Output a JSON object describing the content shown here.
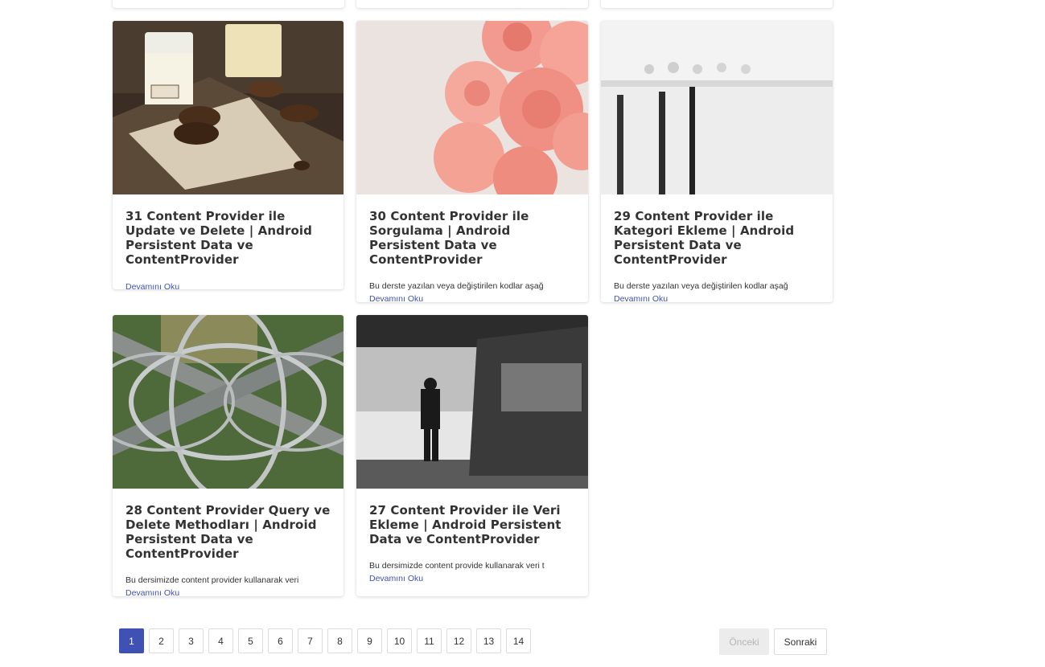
{
  "posts": [
    {
      "title": "31 Content Provider ile Update ve Delete | Android Persistent Data ve ContentProvider",
      "excerpt": "",
      "read_more": "Devamını Oku",
      "image_icon": "milk-cookies-photo"
    },
    {
      "title": "30 Content Provider ile Sorgulama | Android Persistent Data ve ContentProvider",
      "excerpt": "Bu derste yazılan veya değiştirilen kodlar aşağ",
      "read_more": "Devamını Oku",
      "image_icon": "pink-roses-photo"
    },
    {
      "title": "29 Content Provider ile Kategori Ekleme | Android Persistent Data ve ContentProvider",
      "excerpt": "Bu derste yazılan veya değiştirilen kodlar aşağ",
      "read_more": "Devamını Oku",
      "image_icon": "foggy-lake-posts-photo"
    },
    {
      "title": "28 Content Provider Query ve Delete Methodları | Android Persistent Data ve ContentProvider",
      "excerpt": "Bu dersimizde content provider kullanarak veri",
      "read_more": "Devamını Oku",
      "image_icon": "highway-interchange-photo"
    },
    {
      "title": "27 Content Provider ile Veri Ekleme | Android Persistent Data ve ContentProvider",
      "excerpt": "Bu dersimizde content provide kullanarak veri t",
      "read_more": "Devamını Oku",
      "image_icon": "subway-platform-photo"
    }
  ],
  "pagination": {
    "pages": [
      "1",
      "2",
      "3",
      "4",
      "5",
      "6",
      "7",
      "8",
      "9",
      "10",
      "11",
      "12",
      "13",
      "14"
    ],
    "current": "1",
    "prev_label": "Önceki",
    "next_label": "Sonraki",
    "prev_disabled": true
  },
  "colors": {
    "accent": "#3f51b5",
    "text": "#333333",
    "disabled_bg": "#ececec"
  }
}
